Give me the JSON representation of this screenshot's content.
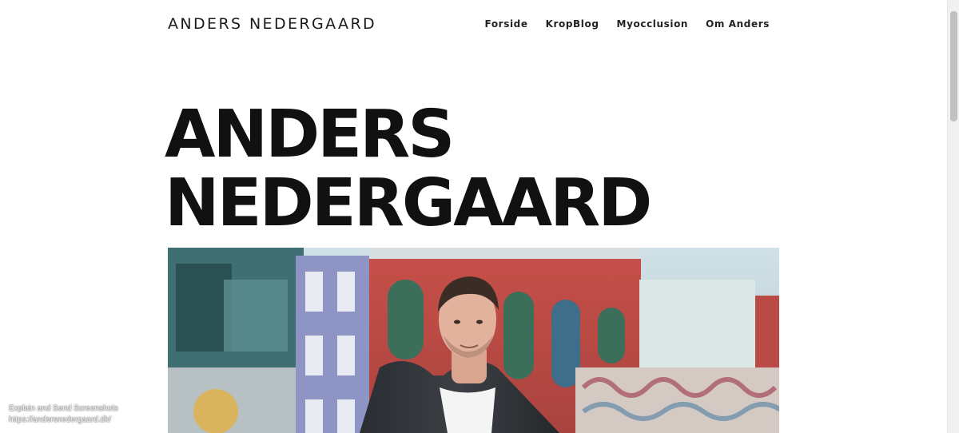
{
  "header": {
    "site_title": "ANDERS NEDERGAARD",
    "nav": [
      {
        "label": "Forside"
      },
      {
        "label": "KropBlog"
      },
      {
        "label": "Myocclusion"
      },
      {
        "label": "Om Anders"
      }
    ]
  },
  "hero": {
    "title_line1": "ANDERS",
    "title_line2": "NEDERGAARD"
  },
  "overlay": {
    "line1": "Explain and Send Screenshots",
    "line2": "https://andersnedergaard.dk/"
  },
  "colors": {
    "text": "#1a1a1a",
    "background": "#ffffff",
    "scrollbar_thumb": "#c1c1c1"
  }
}
